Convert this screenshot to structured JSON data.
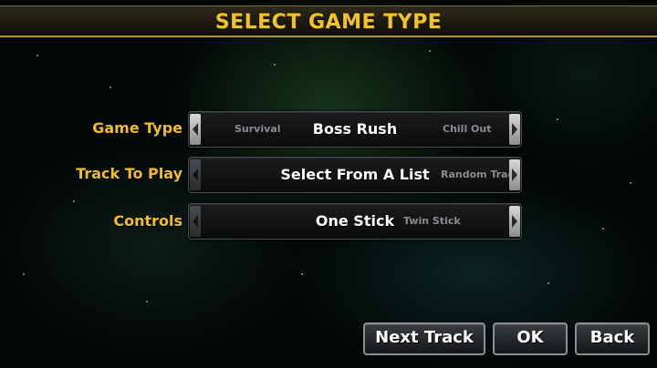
{
  "header": {
    "title": "SELECT GAME TYPE"
  },
  "rows": [
    {
      "label": "Game Type",
      "left_option": "Survival",
      "selected": "Boss Rush",
      "right_option": "Chill Out"
    },
    {
      "label": "Track To Play",
      "left_option": "",
      "selected": "Select From A List",
      "right_option": "Random Track"
    },
    {
      "label": "Controls",
      "left_option": "",
      "selected": "One Stick",
      "right_option": "Twin Stick"
    }
  ],
  "buttons": {
    "next_track": "Next Track",
    "ok": "OK",
    "back": "Back"
  },
  "colors": {
    "accent": "#f2c22a",
    "label": "#f1bd2a",
    "text": "#ffffff",
    "dim_option": "#8a8d90"
  },
  "icons": {
    "left_arrow": "chevron-left-icon",
    "right_arrow": "chevron-right-icon"
  }
}
